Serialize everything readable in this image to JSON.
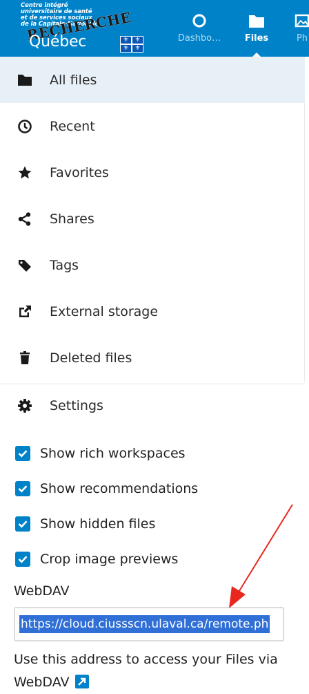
{
  "header": {
    "logo": {
      "line1": "Centre intégré",
      "line2": "universitaire de santé",
      "line3": "et de services sociaux",
      "line4": "de la Capitale-Nationale",
      "stamp": "RECHERCHE",
      "province": "Québec"
    },
    "nav": [
      {
        "label": "Dashbo…",
        "icon": "dashboard-circle-icon"
      },
      {
        "label": "Files",
        "icon": "folder-icon",
        "active": true
      },
      {
        "label": "Ph",
        "icon": "image-icon"
      }
    ],
    "accent": "#0082c9"
  },
  "menu": {
    "items": [
      {
        "label": "All files",
        "icon": "folder-icon",
        "active": true
      },
      {
        "label": "Recent",
        "icon": "clock-icon"
      },
      {
        "label": "Favorites",
        "icon": "star-icon"
      },
      {
        "label": "Shares",
        "icon": "share-icon"
      },
      {
        "label": "Tags",
        "icon": "tag-icon"
      },
      {
        "label": "External storage",
        "icon": "external-link-icon"
      },
      {
        "label": "Deleted files",
        "icon": "trash-icon"
      }
    ],
    "settings_label": "Settings"
  },
  "settings": {
    "checkboxes": [
      {
        "label": "Show rich workspaces",
        "checked": true
      },
      {
        "label": "Show recommendations",
        "checked": true
      },
      {
        "label": "Show hidden files",
        "checked": true
      },
      {
        "label": "Crop image previews",
        "checked": true
      }
    ],
    "webdav_title": "WebDAV",
    "webdav_url": "https://cloud.ciussscn.ulaval.ca/remote.ph",
    "help_text": "Use this address to access your Files via WebDAV",
    "annotation_color": "#e8281e"
  }
}
